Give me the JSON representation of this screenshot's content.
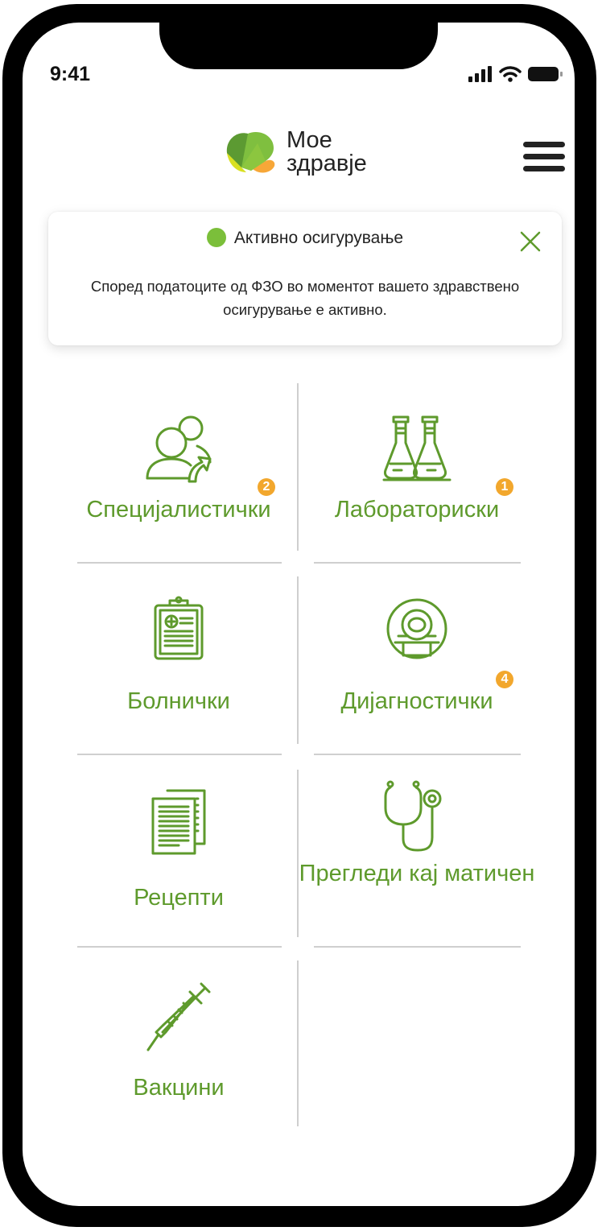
{
  "status_bar": {
    "time": "9:41"
  },
  "app": {
    "logo_line1": "Мое",
    "logo_line2": "здравје"
  },
  "notice": {
    "title": "Активно осигурување",
    "message": "Според податоците од ФЗО во моментот вашето здравствено осигурување е активно.",
    "status_color": "#7bbf3a"
  },
  "menu": {
    "items": [
      {
        "label": "Специјалистички",
        "icon": "specialist-icon",
        "badge": "2"
      },
      {
        "label": "Лабораториски",
        "icon": "lab-flasks-icon",
        "badge": "1"
      },
      {
        "label": "Болнички",
        "icon": "clipboard-icon",
        "badge": ""
      },
      {
        "label": "Дијагностички",
        "icon": "scanner-icon",
        "badge": "4"
      },
      {
        "label": "Рецепти",
        "icon": "documents-icon",
        "badge": ""
      },
      {
        "label": "Прегледи кај матичен",
        "icon": "stethoscope-icon",
        "badge": ""
      },
      {
        "label": "Вакцини",
        "icon": "syringe-icon",
        "badge": ""
      }
    ]
  },
  "colors": {
    "accent": "#5e9a2c",
    "badge": "#f2a72d",
    "divider": "#cfcfcf"
  }
}
